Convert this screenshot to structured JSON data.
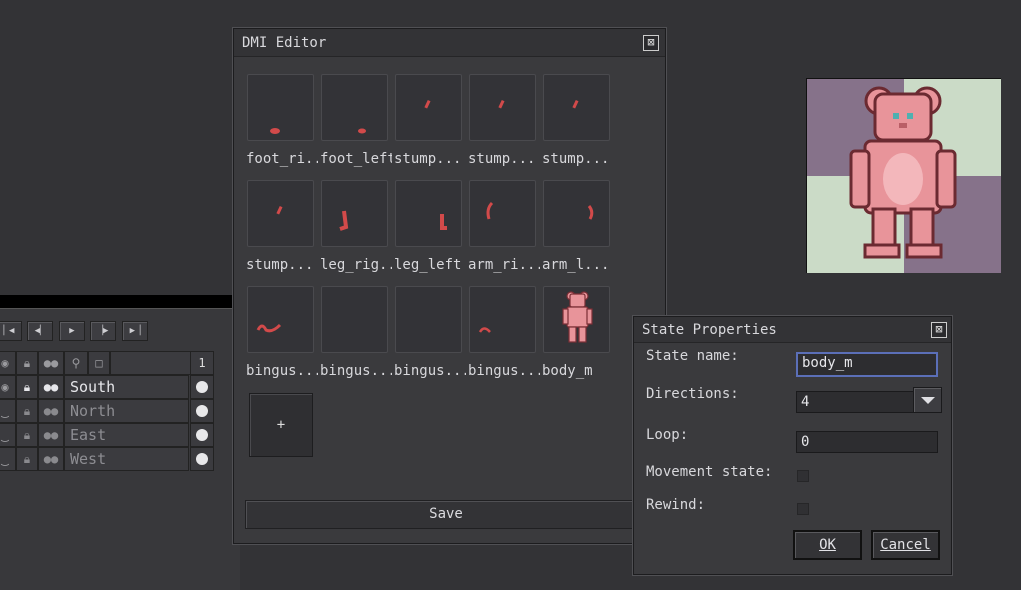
{
  "dmi_editor": {
    "title": "DMI Editor",
    "close_glyph": "⊠",
    "states": [
      {
        "label": "foot_ri...",
        "icon": "foot-right-sprite"
      },
      {
        "label": "foot_left",
        "icon": "foot-left-sprite"
      },
      {
        "label": "stump...",
        "icon": "stump-sprite"
      },
      {
        "label": "stump...",
        "icon": "stump-sprite"
      },
      {
        "label": "stump...",
        "icon": "stump-sprite"
      },
      {
        "label": "stump...",
        "icon": "stump-sprite"
      },
      {
        "label": "leg_rig...",
        "icon": "leg-right-sprite"
      },
      {
        "label": "leg_left",
        "icon": "leg-left-sprite"
      },
      {
        "label": "arm_ri...",
        "icon": "arm-right-sprite"
      },
      {
        "label": "arm_l...",
        "icon": "arm-left-sprite"
      },
      {
        "label": "bingus...",
        "icon": "tail-sprite"
      },
      {
        "label": "bingus...",
        "icon": "empty-sprite"
      },
      {
        "label": "bingus...",
        "icon": "empty-sprite"
      },
      {
        "label": "bingus...",
        "icon": "tail-small-sprite"
      },
      {
        "label": "body_m",
        "icon": "body-sprite"
      }
    ],
    "add_label": "+",
    "save_label": "Save"
  },
  "state_properties": {
    "title": "State Properties",
    "close_glyph": "⊠",
    "state_name_label": "State name:",
    "state_name_value": "body_m",
    "directions_label": "Directions:",
    "directions_value": "4",
    "loop_label": "Loop:",
    "loop_value": "0",
    "movement_label": "Movement state:",
    "movement_checked": false,
    "rewind_label": "Rewind:",
    "rewind_checked": false,
    "ok_label": "OK",
    "cancel_label": "Cancel"
  },
  "timeline": {
    "playback_buttons": [
      "first-frame-icon",
      "prev-frame-icon",
      "play-icon",
      "next-frame-icon",
      "last-frame-icon"
    ],
    "frame_header": "1",
    "layers": [
      {
        "name": "South",
        "active": true
      },
      {
        "name": "North",
        "active": false
      },
      {
        "name": "East",
        "active": false
      },
      {
        "name": "West",
        "active": false
      }
    ]
  },
  "colors": {
    "sprite_red": "#d24a4a",
    "body_pink": "#e8949a",
    "preview_purple": "#86728a",
    "preview_green": "#cbdbc7",
    "focus_blue": "#5b6fb8"
  }
}
